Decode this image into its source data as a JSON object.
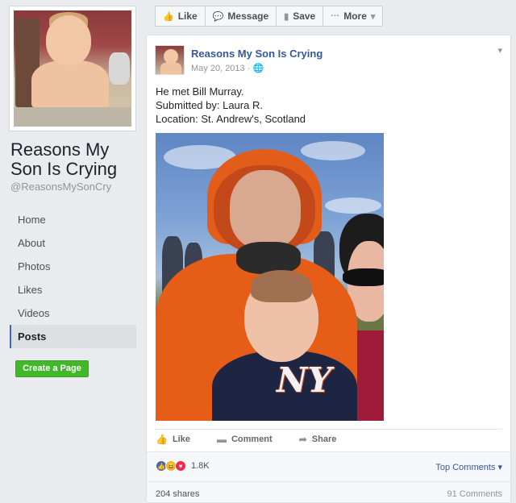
{
  "page": {
    "name": "Reasons My Son Is Crying",
    "handle": "@ReasonsMySonCry"
  },
  "nav": {
    "items": [
      {
        "label": "Home"
      },
      {
        "label": "About"
      },
      {
        "label": "Photos"
      },
      {
        "label": "Likes"
      },
      {
        "label": "Videos"
      },
      {
        "label": "Posts",
        "active": true
      }
    ],
    "create_page_label": "Create a Page"
  },
  "actionbar": {
    "like_label": "Like",
    "message_label": "Message",
    "save_label": "Save",
    "more_label": "More"
  },
  "post": {
    "author": "Reasons My Son Is Crying",
    "date": "May 20, 2013",
    "privacy_icon": "globe-icon",
    "text_lines": [
      "He met Bill Murray.",
      "Submitted by: Laura R.",
      "Location: St. Andrew's, Scotland"
    ],
    "photo_logo_text": "NY",
    "actions": {
      "like_label": "Like",
      "comment_label": "Comment",
      "share_label": "Share"
    },
    "reactions": {
      "types": [
        "like",
        "haha",
        "love"
      ],
      "count": "1.8K"
    },
    "top_comments_label": "Top Comments",
    "shares_label": "204 shares",
    "comments_label": "91 Comments"
  },
  "colors": {
    "link": "#365899",
    "create_page_bg": "#42b72a",
    "background": "#e9ebee",
    "active_nav_border": "#4267b2"
  }
}
